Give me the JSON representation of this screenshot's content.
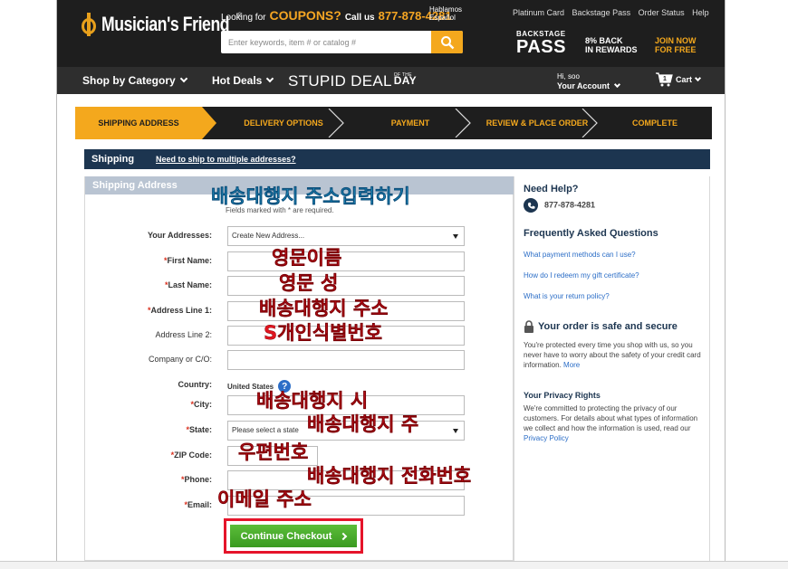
{
  "header": {
    "logo_text": "Musician's Friend",
    "logo_tm": "®",
    "promo_prefix": "Looking for",
    "promo_coupons": "COUPONS?",
    "promo_callus": "Call us",
    "promo_phone": "877-878-4281",
    "hablamos_1": "Hablamos",
    "hablamos_2": "Español",
    "top_links": [
      "Platinum Card",
      "Backstage Pass",
      "Order Status",
      "Help"
    ],
    "search_placeholder": "Enter keywords, item # or catalog #",
    "backstage_small": "BACKSTAGE",
    "backstage_big": "PASS",
    "rewards_1": "8% BACK",
    "rewards_2": "IN REWARDS",
    "join_1": "JOIN NOW",
    "join_2": "FOR FREE"
  },
  "nav": {
    "shop_by_category": "Shop by Category",
    "hot_deals": "Hot Deals",
    "stupid_deal": "STUPID DEAL",
    "of_the": "OF THE",
    "day": "DAY",
    "hi_user": "Hi, soo",
    "your_account": "Your Account",
    "cart_count": "1",
    "cart_label": "Cart"
  },
  "steps": [
    {
      "label": "SHIPPING ADDRESS",
      "active": true
    },
    {
      "label": "DELIVERY OPTIONS",
      "active": false
    },
    {
      "label": "PAYMENT",
      "active": false
    },
    {
      "label": "REVIEW & PLACE ORDER",
      "active": false
    },
    {
      "label": "COMPLETE",
      "active": false
    }
  ],
  "shipping_bar": {
    "title": "Shipping",
    "multi_link": "Need to ship to multiple addresses?"
  },
  "form": {
    "heading": "Shipping Address",
    "required_note": "Fields marked with * are required.",
    "your_addresses_label": "Your Addresses:",
    "your_addresses_value": "Create New Address...",
    "first_name_label": "First Name:",
    "last_name_label": "Last Name:",
    "address1_label": "Address Line 1:",
    "address2_label": "Address Line 2:",
    "company_label": "Company or C/O:",
    "country_label": "Country:",
    "country_value": "United States",
    "city_label": "City:",
    "state_label": "State:",
    "state_value": "Please select a state",
    "zip_label": "ZIP Code:",
    "phone_label": "Phone:",
    "email_label": "Email:",
    "required_star": "*",
    "continue_label": "Continue Checkout"
  },
  "sidebar": {
    "need_help": "Need Help?",
    "phone": "877-878-4281",
    "faq_title": "Frequently Asked Questions",
    "faq_links": [
      "What payment methods can I use?",
      "How do I redeem my gift certificate?",
      "What is your return policy?"
    ],
    "secure_title": "Your order is safe and secure",
    "secure_text": "You're protected every time you shop with us, so you never have to worry about the safety of your credit card information.",
    "secure_more": "More",
    "privacy_title": "Your Privacy Rights",
    "privacy_text": "We're committed to protecting the privacy of our customers. For details about what types of information we collect and how the information is used, read our",
    "privacy_link": "Privacy Policy"
  },
  "annotations": {
    "title": "배송대행지 주소입력하기",
    "first_name": "영문이름",
    "last_name": "영문 성",
    "address1": "배송대행지 주소",
    "address2": "S개인식별번호",
    "city": "배송대행지 시",
    "state": "배송대행지 주",
    "zip": "우편번호",
    "phone": "배송대행지 전화번호",
    "email": "이메일 주소"
  },
  "colors": {
    "brand_orange": "#f4a81d",
    "header_dark": "#1e1e1e",
    "ship_bar_navy": "#1c3550",
    "continue_green": "#3a9a21",
    "annotation_red": "#e0151f",
    "annotation_blue": "#26a6d6"
  }
}
